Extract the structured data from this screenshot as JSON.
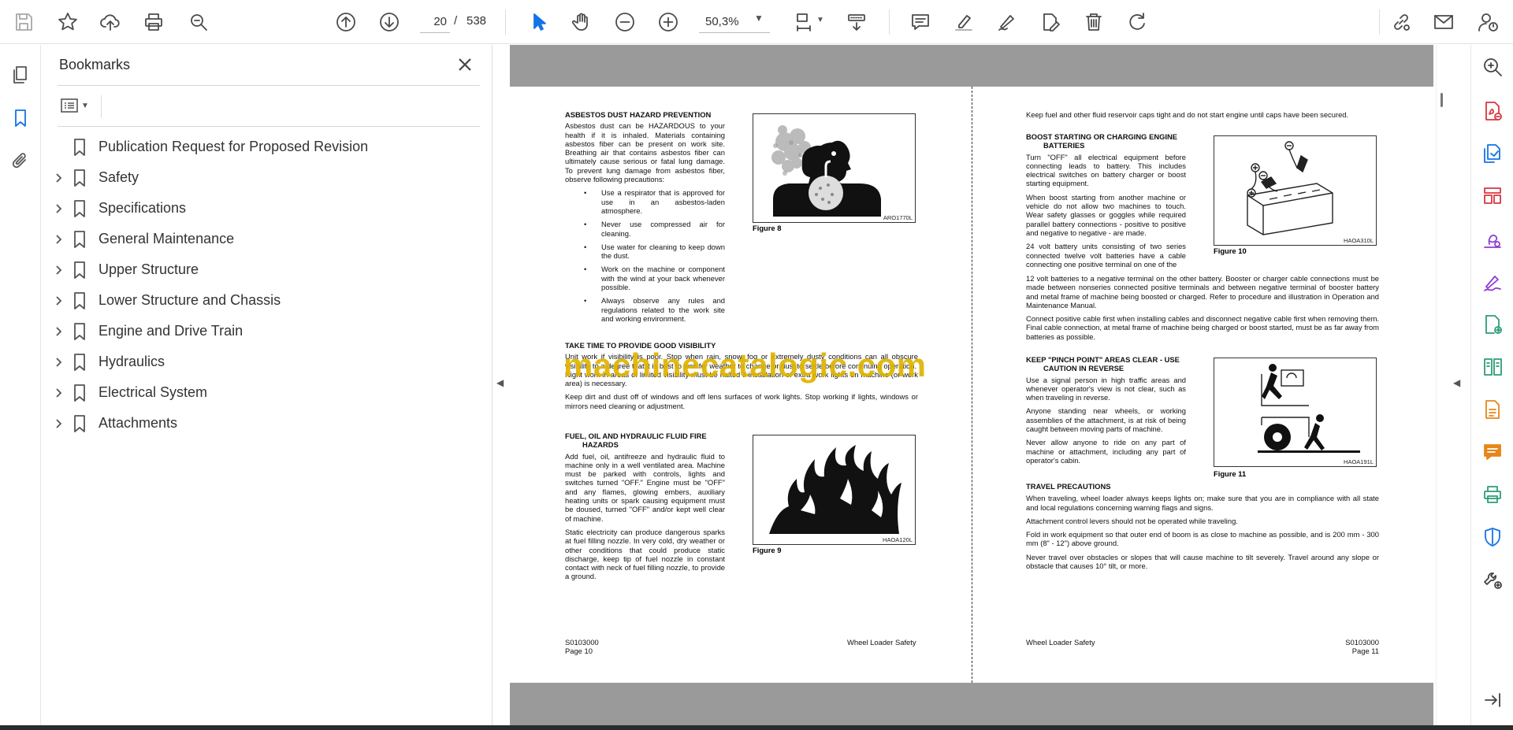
{
  "toolbar": {
    "page_current": "20",
    "page_separator": "/",
    "page_total": "538",
    "zoom": "50,3%"
  },
  "bookmarks": {
    "title": "Bookmarks",
    "items": [
      {
        "label": "Publication Request for Proposed Revision",
        "expandable": false
      },
      {
        "label": "Safety",
        "expandable": true
      },
      {
        "label": "Specifications",
        "expandable": true
      },
      {
        "label": "General Maintenance",
        "expandable": true
      },
      {
        "label": "Upper Structure",
        "expandable": true
      },
      {
        "label": "Lower Structure and Chassis",
        "expandable": true
      },
      {
        "label": "Engine and Drive Train",
        "expandable": true
      },
      {
        "label": "Hydraulics",
        "expandable": true
      },
      {
        "label": "Electrical System",
        "expandable": true
      },
      {
        "label": "Attachments",
        "expandable": true
      }
    ]
  },
  "left_page": {
    "asbestos": {
      "heading": "ASBESTOS DUST HAZARD PREVENTION",
      "body": "Asbestos dust can be HAZARDOUS to your health if it is inhaled. Materials containing asbestos fiber can be present on work site. Breathing air that contains asbestos fiber can ultimately cause serious or fatal lung damage. To prevent lung damage from asbestos fiber, observe following precautions:",
      "bullets": [
        "Use a respirator that is approved for use in an asbestos-laden atmosphere.",
        "Never use compressed air for cleaning.",
        "Use water for cleaning to keep down the dust.",
        "Work on the machine or component with the wind at your back whenever possible.",
        "Always observe any rules and regulations related to the work site and working environment."
      ],
      "figure_code": "ARO1770L",
      "figure_caption": "Figure 8"
    },
    "visibility": {
      "heading": "TAKE TIME TO PROVIDE GOOD VISIBILITY",
      "body1": "Unit work if visibility is poor. Stop when rain, snow, fog or extremely dusty conditions can all obscure visibility to a degree that it is best to wait for weather to change or dust to settle before continuing operation.",
      "body2": "Night work in areas of limited visibility must be halted if installation of extra work lights on machine (or work area) is necessary.",
      "body3": "Keep dirt and dust off of windows and off lens surfaces of work lights. Stop working if lights, windows or mirrors need cleaning or adjustment."
    },
    "fuel": {
      "heading_line1": "FUEL, OIL AND HYDRAULIC FLUID FIRE",
      "heading_line2": "HAZARDS",
      "body1": "Add fuel, oil, antifreeze and hydraulic fluid to machine only in a well ventilated area. Machine must be parked with controls, lights and switches turned \"OFF.\" Engine must be \"OFF\" and any flames, glowing embers, auxiliary heating units or spark causing equipment must be doused, turned \"OFF\" and/or kept well clear of machine.",
      "body2": "Static electricity can produce dangerous sparks at fuel filling nozzle. In very cold, dry weather or other conditions that could produce static discharge, keep tip of fuel nozzle in constant contact with neck of fuel filling nozzle, to provide a ground.",
      "figure_code": "HAOA120L",
      "figure_caption": "Figure 9"
    },
    "footer": {
      "code": "S0103000",
      "page": "Page 10",
      "title": "Wheel Loader Safety"
    }
  },
  "right_page": {
    "intro": "Keep fuel and other fluid reservoir caps tight and do not start engine until caps have been secured.",
    "boost": {
      "heading_line1": "BOOST STARTING OR CHARGING ENGINE",
      "heading_line2": "BATTERIES",
      "body1": "Turn \"OFF\" all electrical equipment before connecting leads to battery. This includes electrical switches on battery charger or boost starting equipment.",
      "body2": "When boost starting from another machine or vehicle do not allow two machines to touch. Wear safety glasses or goggles while required parallel battery connections - positive to positive and negative to negative - are made.",
      "body3a": "24 volt battery units consisting of two series connected twelve volt batteries have a cable connecting one positive terminal on one of the",
      "body3b": "12 volt batteries to a negative terminal on the other battery. Booster or charger cable connections must be made between nonseries connected positive terminals and between negative terminal of booster battery and metal frame of machine being boosted or charged. Refer to procedure and illustration in Operation and Maintenance Manual.",
      "body4": "Connect positive cable first when installing cables and disconnect negative cable first when removing them. Final cable connection, at metal frame of machine being charged or boost started, must be as far away from batteries as possible.",
      "figure_code": "HAOA310L",
      "figure_caption": "Figure 10"
    },
    "pinch": {
      "heading_line1": "KEEP \"PINCH POINT\" AREAS CLEAR - USE",
      "heading_line2": "CAUTION IN REVERSE",
      "body1": "Use a signal person in high traffic areas and whenever operator's view is not clear, such as when traveling in reverse.",
      "body2": "Anyone standing near wheels, or working assemblies of the attachment, is at risk of being caught between moving parts of machine.",
      "body3": "Never allow anyone to ride on any part of machine or attachment, including any part of operator's cabin.",
      "figure_code": "HAOA191L",
      "figure_caption": "Figure 11"
    },
    "travel": {
      "heading": "TRAVEL PRECAUTIONS",
      "body1": "When traveling, wheel loader always keeps lights on; make sure that you are in compliance with all state and local regulations concerning warning flags and signs.",
      "body2": "Attachment control levers should not be operated while traveling.",
      "body3": "Fold in work equipment so that outer end of boom is as close to machine as possible, and is 200 mm - 300 mm (8\" - 12\") above ground.",
      "body4": "Never travel over obstacles or slopes that will cause machine to tilt severely. Travel around any slope or obstacle that causes 10° tilt, or more."
    },
    "footer": {
      "code": "S0103000",
      "page": "Page 11",
      "title": "Wheel Loader Safety"
    }
  },
  "watermark": "machinecatalogic.com",
  "colors": {
    "accent": "#1473e6",
    "page_gray": "#9a9a9a",
    "watermark": "#e0b400"
  }
}
